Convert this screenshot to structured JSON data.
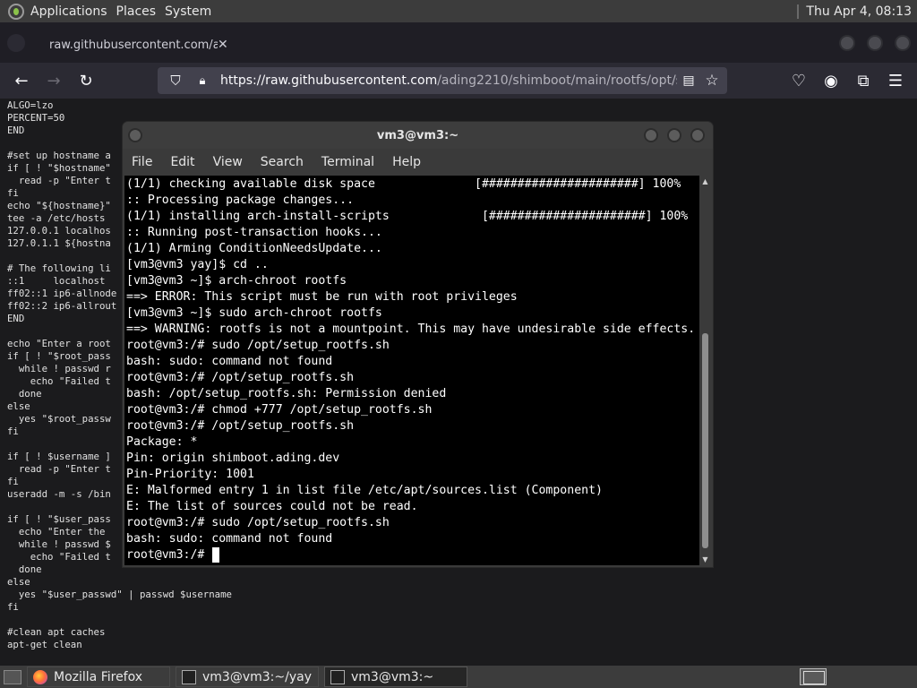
{
  "top_panel": {
    "menus": [
      "Applications",
      "Places",
      "System"
    ],
    "clock": "Thu Apr  4, 08:13"
  },
  "firefox": {
    "tab_title": "raw.githubusercontent.com/adi",
    "url_host": "https://raw.githubusercontent.com",
    "url_rest": "/ading2210/shimboot/main/rootfs/opt/setup_r",
    "icons": [
      "back-icon",
      "forward-icon",
      "reload-icon",
      "shield-icon",
      "lock-icon",
      "reader-view-icon",
      "bookmark-star-icon",
      "pocket-icon",
      "account-icon",
      "extensions-icon",
      "menu-icon"
    ]
  },
  "page_text": "ALGO=lzo\nPERCENT=50\nEND\n\n#set up hostname a\nif [ ! \"$hostname\"\n  read -p \"Enter t\nfi\necho \"${hostname}\"\ntee -a /etc/hosts\n127.0.0.1 localhos\n127.0.1.1 ${hostna\n\n# The following li\n::1     localhost\nff02::1 ip6-allnode\nff02::2 ip6-allrout\nEND\n\necho \"Enter a root\nif [ ! \"$root_pass\n  while ! passwd r\n    echo \"Failed t\n  done\nelse\n  yes \"$root_passw\nfi\n\nif [ ! $username ]\n  read -p \"Enter t\nfi\nuseradd -m -s /bin\n\nif [ ! \"$user_pass\n  echo \"Enter the\n  while ! passwd $\n    echo \"Failed t\n  done\nelse\n  yes \"$user_passwd\" | passwd $username\nfi\n\n#clean apt caches\napt-get clean",
  "terminal": {
    "title": "vm3@vm3:~",
    "menu": [
      "File",
      "Edit",
      "View",
      "Search",
      "Terminal",
      "Help"
    ],
    "output": "(1/1) checking available disk space              [######################] 100%\n:: Processing package changes...\n(1/1) installing arch-install-scripts             [######################] 100%\n:: Running post-transaction hooks...\n(1/1) Arming ConditionNeedsUpdate...\n[vm3@vm3 yay]$ cd ..\n[vm3@vm3 ~]$ arch-chroot rootfs\n==> ERROR: This script must be run with root privileges\n[vm3@vm3 ~]$ sudo arch-chroot rootfs\n==> WARNING: rootfs is not a mountpoint. This may have undesirable side effects.\nroot@vm3:/# sudo /opt/setup_rootfs.sh\nbash: sudo: command not found\nroot@vm3:/# /opt/setup_rootfs.sh\nbash: /opt/setup_rootfs.sh: Permission denied\nroot@vm3:/# chmod +777 /opt/setup_rootfs.sh\nroot@vm3:/# /opt/setup_rootfs.sh\nPackage: *\nPin: origin shimboot.ading.dev\nPin-Priority: 1001\nE: Malformed entry 1 in list file /etc/apt/sources.list (Component)\nE: The list of sources could not be read.\nroot@vm3:/# sudo /opt/setup_rootfs.sh\nbash: sudo: command not found\nroot@vm3:/# "
  },
  "taskbar": {
    "items": [
      {
        "label": "Mozilla Firefox",
        "icon": "firefox-icon"
      },
      {
        "label": "vm3@vm3:~/yay",
        "icon": "terminal-icon"
      },
      {
        "label": "vm3@vm3:~",
        "icon": "terminal-icon"
      }
    ]
  }
}
